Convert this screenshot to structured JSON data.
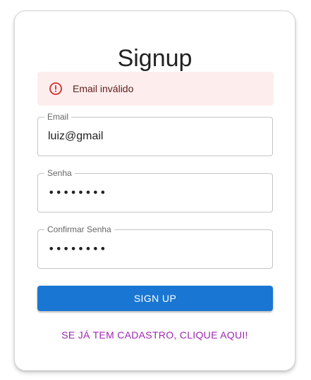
{
  "page": {
    "title": "Signup"
  },
  "alert": {
    "icon": "error-outline-icon",
    "message": "Email inválido",
    "colors": {
      "background": "#fdeded",
      "icon": "#d32f2f",
      "text": "#5f2120"
    }
  },
  "form": {
    "email": {
      "label": "Email",
      "value": "luiz@gmail"
    },
    "password": {
      "label": "Senha",
      "value": "••••••••"
    },
    "confirm_password": {
      "label": "Confirmar Senha",
      "value": "••••••••"
    }
  },
  "actions": {
    "signup_label": "SIGN UP",
    "login_link_label": "SE JÁ TEM CADASTRO, CLIQUE AQUI!",
    "colors": {
      "primary": "#1976d2",
      "link": "#9c27b0"
    }
  }
}
